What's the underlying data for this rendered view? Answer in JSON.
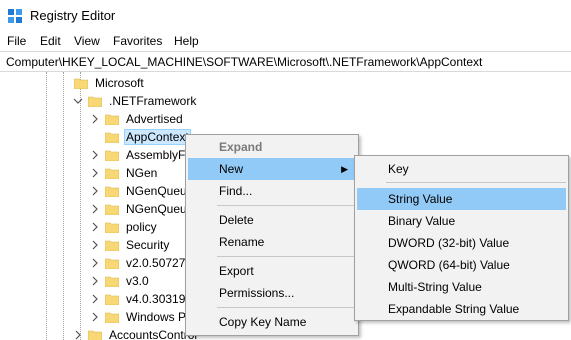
{
  "window": {
    "title": "Registry Editor",
    "icon": "registry-editor-icon"
  },
  "menubar": {
    "file": "File",
    "edit": "Edit",
    "view": "View",
    "favorites": "Favorites",
    "help": "Help"
  },
  "address": {
    "path": "Computer\\HKEY_LOCAL_MACHINE\\SOFTWARE\\Microsoft\\.NETFramework\\AppContext"
  },
  "tree": {
    "microsoft": "Microsoft",
    "netframework": ".NETFramework",
    "children": [
      "Advertised",
      "AppContext",
      "AssemblyFo",
      "NGen",
      "NGenQueue",
      "NGenQueue",
      "policy",
      "Security",
      "v2.0.50727",
      "v3.0",
      "v4.0.30319",
      "Windows Pr"
    ],
    "accountscontrol": "AccountsControl"
  },
  "context_menu": {
    "expand": "Expand",
    "new": "New",
    "find": "Find...",
    "delete": "Delete",
    "rename": "Rename",
    "export": "Export",
    "permissions": "Permissions...",
    "copy_key_name": "Copy Key Name"
  },
  "new_submenu": {
    "key": "Key",
    "string_value": "String Value",
    "binary_value": "Binary Value",
    "dword_value": "DWORD (32-bit) Value",
    "qword_value": "QWORD (64-bit) Value",
    "multi_string_value": "Multi-String Value",
    "expandable_string_value": "Expandable String Value"
  },
  "colors": {
    "selection": "#cce8ff",
    "menu_hover": "#91c9f7",
    "folder": "#f8d775",
    "menu_bg": "#f2f2f2"
  }
}
